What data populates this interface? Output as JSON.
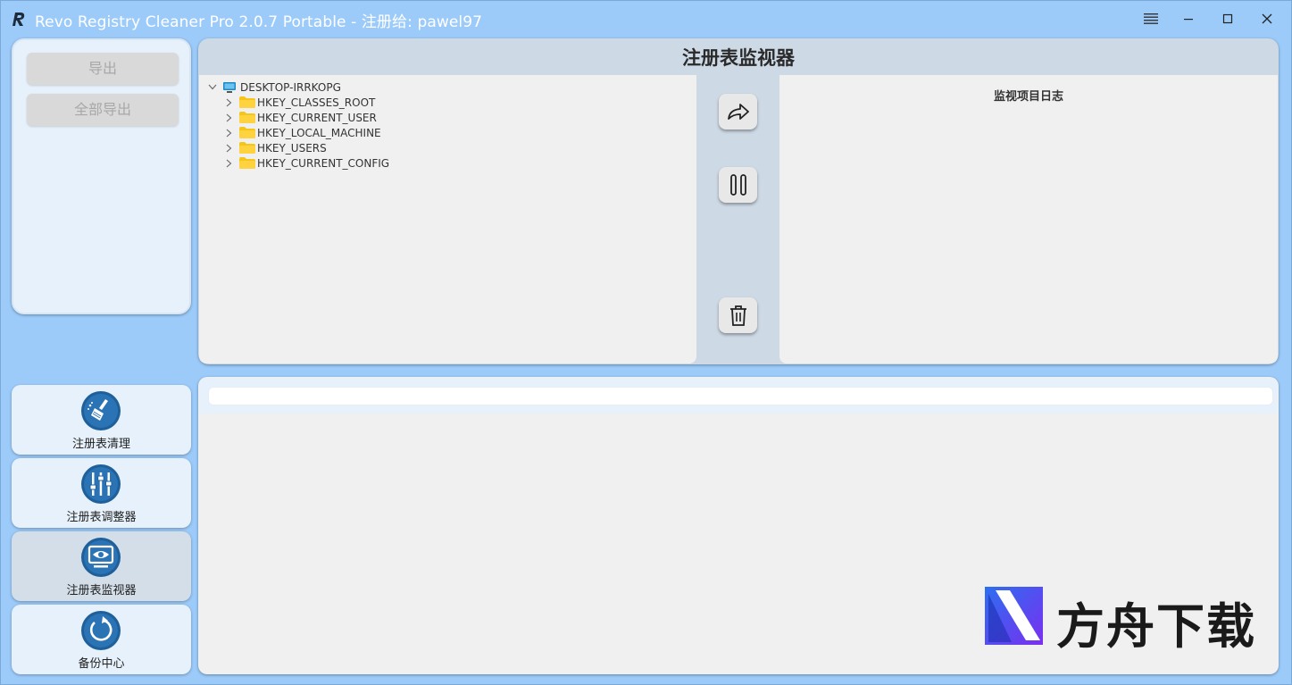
{
  "window": {
    "title": "Revo Registry Cleaner Pro 2.0.7 Portable - 注册给: pawel97"
  },
  "left_panel": {
    "export_label": "导出",
    "export_all_label": "全部导出"
  },
  "nav": {
    "items": [
      {
        "label": "注册表清理",
        "icon": "broom-icon",
        "active": false
      },
      {
        "label": "注册表调整器",
        "icon": "sliders-icon",
        "active": false
      },
      {
        "label": "注册表监视器",
        "icon": "monitor-eye-icon",
        "active": true
      },
      {
        "label": "备份中心",
        "icon": "backup-refresh-icon",
        "active": false
      }
    ]
  },
  "monitor": {
    "title": "注册表监视器",
    "tree": {
      "root": "DESKTOP-IRRKOPG",
      "children": [
        "HKEY_CLASSES_ROOT",
        "HKEY_CURRENT_USER",
        "HKEY_LOCAL_MACHINE",
        "HKEY_USERS",
        "HKEY_CURRENT_CONFIG"
      ]
    },
    "log_header": "监视项目日志"
  },
  "watermark": {
    "text": "方舟下载"
  },
  "colors": {
    "background": "#9ccbfa",
    "panel": "#f0f0f0",
    "header": "#cdd9e5",
    "folder": "#f5c518",
    "nav_icon": "#1f5f9a"
  }
}
